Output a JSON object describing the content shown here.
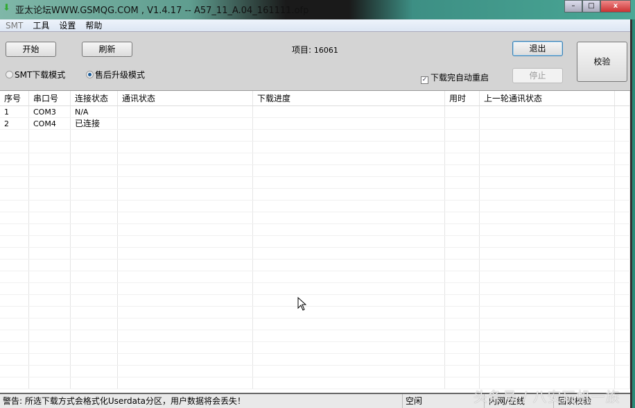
{
  "window": {
    "title": "亚太论坛WWW.GSMQG.COM   , V1.4.17 -- A57_11_A.04_161111.ofp",
    "minimize": "–",
    "maximize": "□",
    "close": "x"
  },
  "menu": [
    "SMT",
    "工具",
    "设置",
    "帮助"
  ],
  "toolbar": {
    "start": "开始",
    "refresh": "刷新",
    "project_label": "项目:",
    "project_value": "16061",
    "exit": "退出",
    "stop": "停止",
    "verify": "校验",
    "mode_smt": "SMT下载模式",
    "mode_after_sales": "售后升级模式",
    "selected_mode": "售后升级模式",
    "auto_restart": "下载完自动重启",
    "auto_restart_checked": true
  },
  "table": {
    "columns": [
      "序号",
      "串口号",
      "连接状态",
      "通讯状态",
      "下载进度",
      "用时",
      "上一轮通讯状态"
    ],
    "rows": [
      [
        "1",
        "COM3",
        "N/A",
        "",
        "",
        "",
        ""
      ],
      [
        "2",
        "COM4",
        "已连接",
        "",
        "",
        "",
        ""
      ]
    ]
  },
  "status": {
    "warning": "警告: 所选下载方式会格式化Userdata分区，用户数据将会丢失！",
    "state": "空闲",
    "network": "内网/在线",
    "readback": "回读校验"
  },
  "watermark": "头条号 / 八安玩机一族"
}
